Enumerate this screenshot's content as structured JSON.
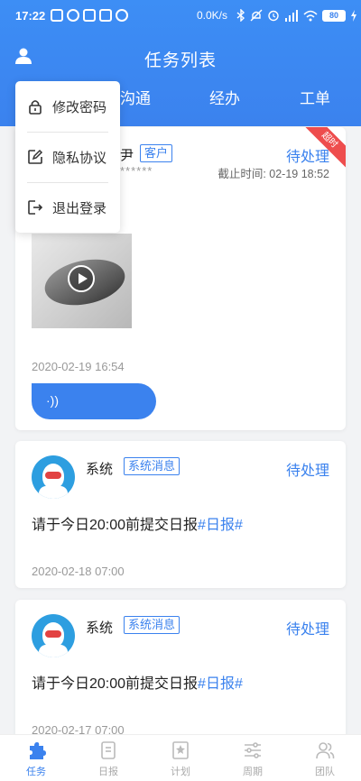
{
  "statusbar": {
    "time": "17:22",
    "speed": "0.0K/s",
    "battery": "80"
  },
  "header": {
    "title": "任务列表"
  },
  "tabs": [
    {
      "label": "沟通"
    },
    {
      "label": "经办"
    },
    {
      "label": "工单"
    }
  ],
  "dropdown": {
    "items": [
      {
        "label": "修改密码",
        "icon": "lock-icon"
      },
      {
        "label": "隐私协议",
        "icon": "edit-icon"
      },
      {
        "label": "退出登录",
        "icon": "logout-icon"
      }
    ]
  },
  "cards": [
    {
      "name": "尹",
      "tag": "客户",
      "masked": "******",
      "status": "待处理",
      "deadline": "截止时间: 02-19 18:52",
      "ribbon": "超时",
      "timestamp": "2020-02-19 16:54",
      "voice_icon": "·))"
    },
    {
      "name": "系统",
      "tag": "系统消息",
      "status": "待处理",
      "message": "请于今日20:00前提交日报",
      "hashtag": "#日报#",
      "timestamp": "2020-02-18 07:00"
    },
    {
      "name": "系统",
      "tag": "系统消息",
      "status": "待处理",
      "message": "请于今日20:00前提交日报",
      "hashtag": "#日报#",
      "timestamp": "2020-02-17 07:00"
    }
  ],
  "tabbar": [
    {
      "label": "任务",
      "icon": "tasks-icon",
      "active": true
    },
    {
      "label": "日报",
      "icon": "daily-report-icon",
      "active": false
    },
    {
      "label": "计划",
      "icon": "plan-icon",
      "active": false
    },
    {
      "label": "周期",
      "icon": "cycle-icon",
      "active": false
    },
    {
      "label": "团队",
      "icon": "team-icon",
      "active": false
    }
  ],
  "colors": {
    "primary": "#3b82ee",
    "overdue": "#ee4d4d"
  }
}
